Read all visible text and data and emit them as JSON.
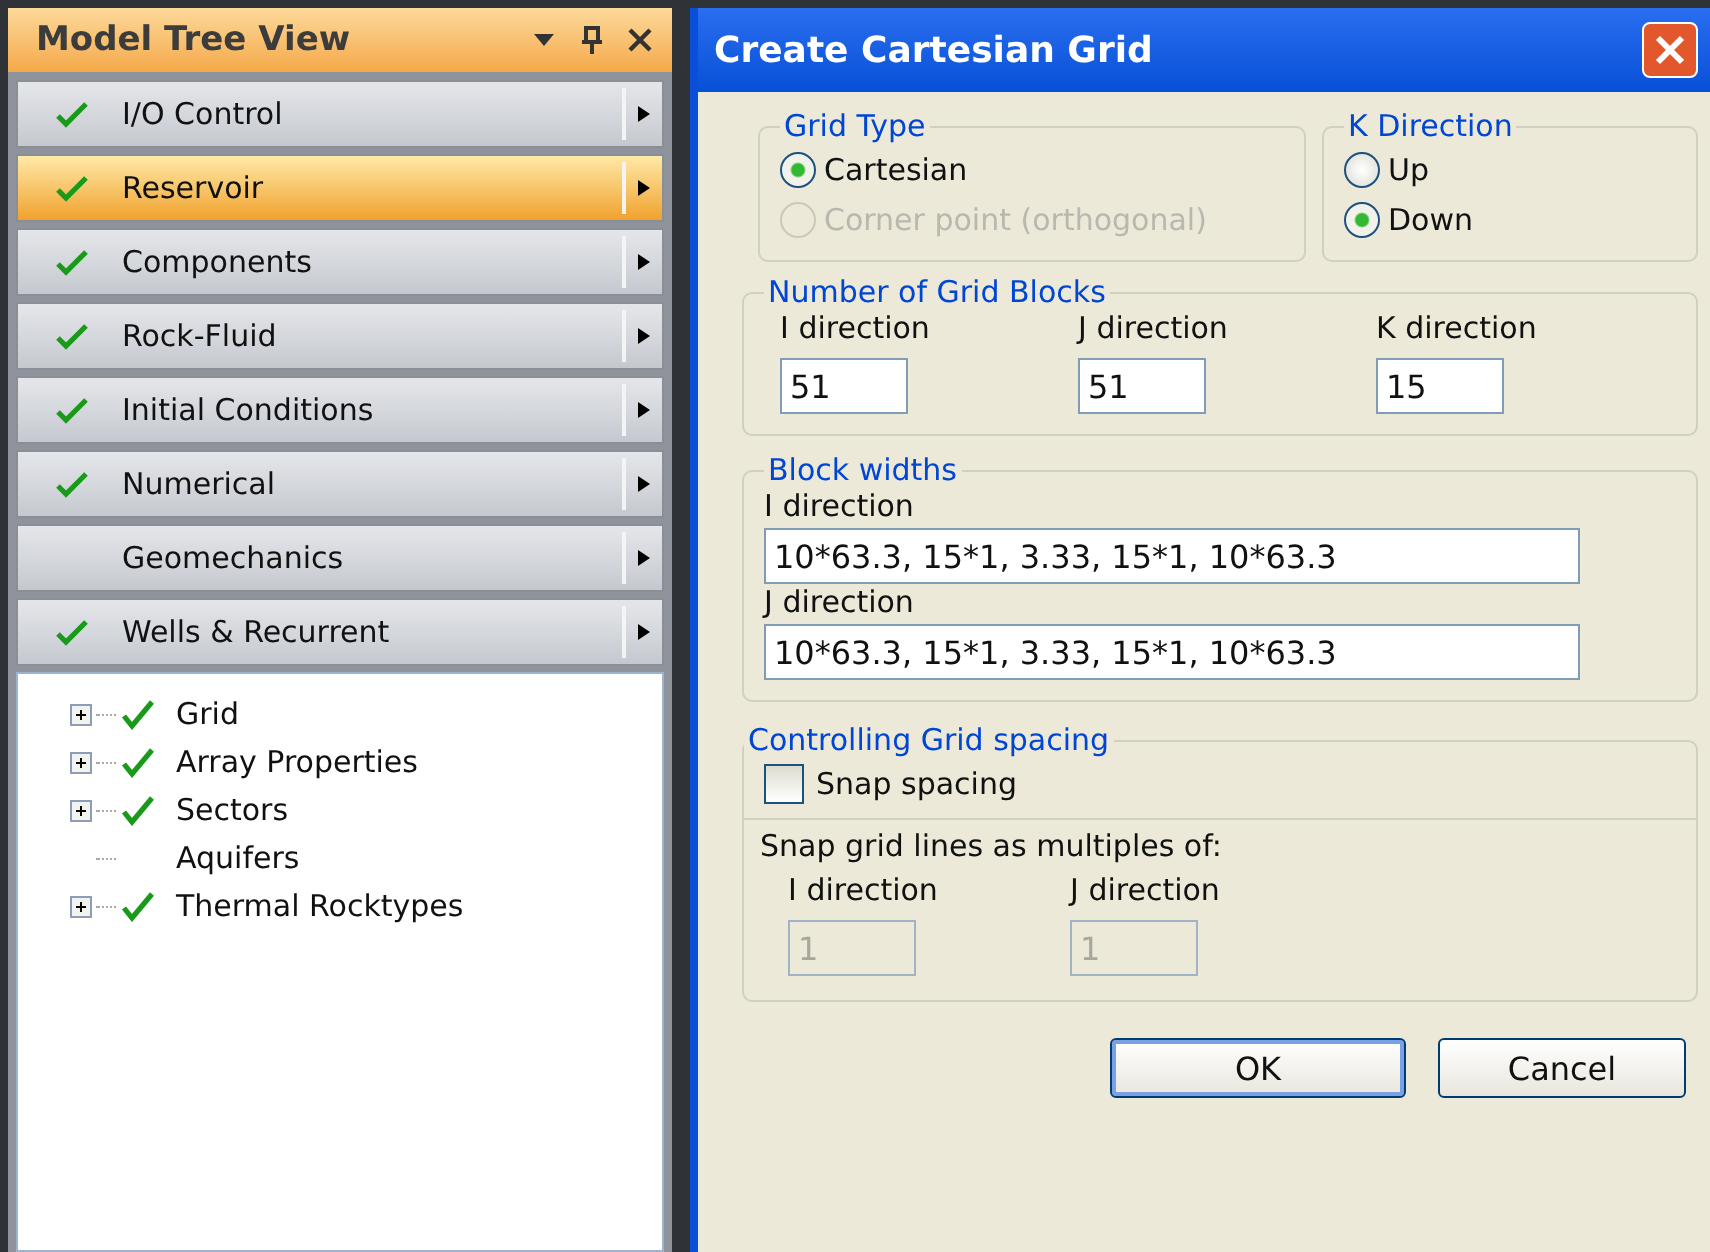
{
  "panel": {
    "title": "Model Tree View",
    "sections": [
      {
        "label": "I/O Control",
        "checked": true,
        "selected": false
      },
      {
        "label": "Reservoir",
        "checked": true,
        "selected": true
      },
      {
        "label": "Components",
        "checked": true,
        "selected": false
      },
      {
        "label": "Rock-Fluid",
        "checked": true,
        "selected": false
      },
      {
        "label": "Initial Conditions",
        "checked": true,
        "selected": false
      },
      {
        "label": "Numerical",
        "checked": true,
        "selected": false
      },
      {
        "label": "Geomechanics",
        "checked": false,
        "selected": false
      },
      {
        "label": "Wells & Recurrent",
        "checked": true,
        "selected": false
      }
    ],
    "tree": [
      {
        "label": "Grid",
        "checked": true,
        "expandable": true
      },
      {
        "label": "Array Properties",
        "checked": true,
        "expandable": true
      },
      {
        "label": "Sectors",
        "checked": true,
        "expandable": true
      },
      {
        "label": "Aquifers",
        "checked": false,
        "expandable": false
      },
      {
        "label": "Thermal Rocktypes",
        "checked": true,
        "expandable": true
      }
    ]
  },
  "dialog": {
    "title": "Create Cartesian Grid",
    "grid_type": {
      "legend": "Grid Type",
      "options": [
        {
          "label": "Cartesian",
          "selected": true,
          "disabled": false
        },
        {
          "label": "Corner point (orthogonal)",
          "selected": false,
          "disabled": true
        }
      ]
    },
    "k_direction": {
      "legend": "K Direction",
      "options": [
        {
          "label": "Up",
          "selected": false,
          "disabled": false
        },
        {
          "label": "Down",
          "selected": true,
          "disabled": false
        }
      ]
    },
    "grid_blocks": {
      "legend": "Number of Grid Blocks",
      "fields": [
        {
          "label": "I direction",
          "value": "51"
        },
        {
          "label": "J direction",
          "value": "51"
        },
        {
          "label": "K direction",
          "value": "15"
        }
      ]
    },
    "block_widths": {
      "legend": "Block widths",
      "fields": [
        {
          "label": "I direction",
          "value": "10*63.3, 15*1, 3.33, 15*1, 10*63.3"
        },
        {
          "label": "J direction",
          "value": "10*63.3, 15*1, 3.33, 15*1, 10*63.3"
        }
      ]
    },
    "spacing": {
      "legend": "Controlling Grid spacing",
      "checkbox": {
        "label": "Snap spacing",
        "checked": false
      },
      "sub_label": "Snap grid lines as multiples of:",
      "fields": [
        {
          "label": "I direction",
          "value": "1",
          "disabled": true
        },
        {
          "label": "J direction",
          "value": "1",
          "disabled": true
        }
      ]
    },
    "buttons": [
      {
        "label": "OK",
        "default": true
      },
      {
        "label": "Cancel",
        "default": false
      }
    ]
  }
}
